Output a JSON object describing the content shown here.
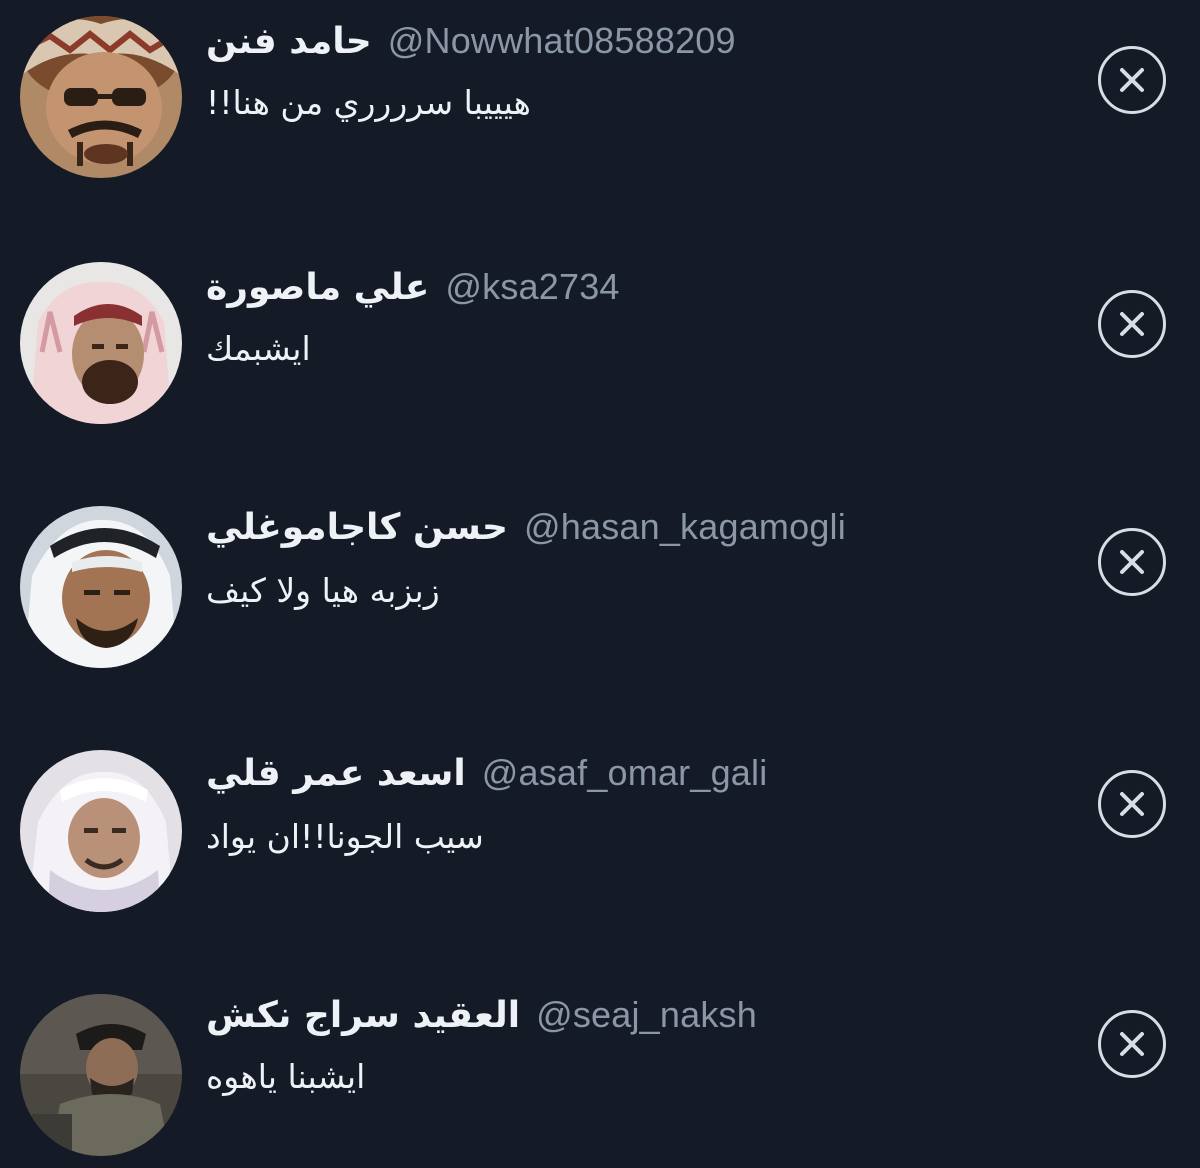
{
  "colors": {
    "background": "#141b27",
    "name_text": "#eef1f5",
    "handle_text": "#8b97a6",
    "dismiss_icon": "#d8dde5"
  },
  "replies": [
    {
      "display_name": "حامد فنن",
      "handle": "@Nowwhat08588209",
      "text": "هيييبا سرررري من هنا!!",
      "avatar_icon": "avatar-photo",
      "dismiss_icon": "close-circle-icon"
    },
    {
      "display_name": "علي ماصورة",
      "handle": "@ksa2734",
      "text": "ايشبمك",
      "avatar_icon": "avatar-photo",
      "dismiss_icon": "close-circle-icon"
    },
    {
      "display_name": "حسن كاجاموغلي",
      "handle": "@hasan_kagamogli",
      "text": "زبزبه هيا ولا كيف",
      "avatar_icon": "avatar-photo",
      "dismiss_icon": "close-circle-icon"
    },
    {
      "display_name": "اسعد عمر قلي",
      "handle": "@asaf_omar_gali",
      "text": "سيب الجونا!!ان يواد",
      "avatar_icon": "avatar-photo",
      "dismiss_icon": "close-circle-icon"
    },
    {
      "display_name": "العقيد سراج نكش",
      "handle": "@seaj_naksh",
      "text": "ايشبنا ياهوه",
      "avatar_icon": "avatar-photo",
      "dismiss_icon": "close-circle-icon"
    }
  ]
}
